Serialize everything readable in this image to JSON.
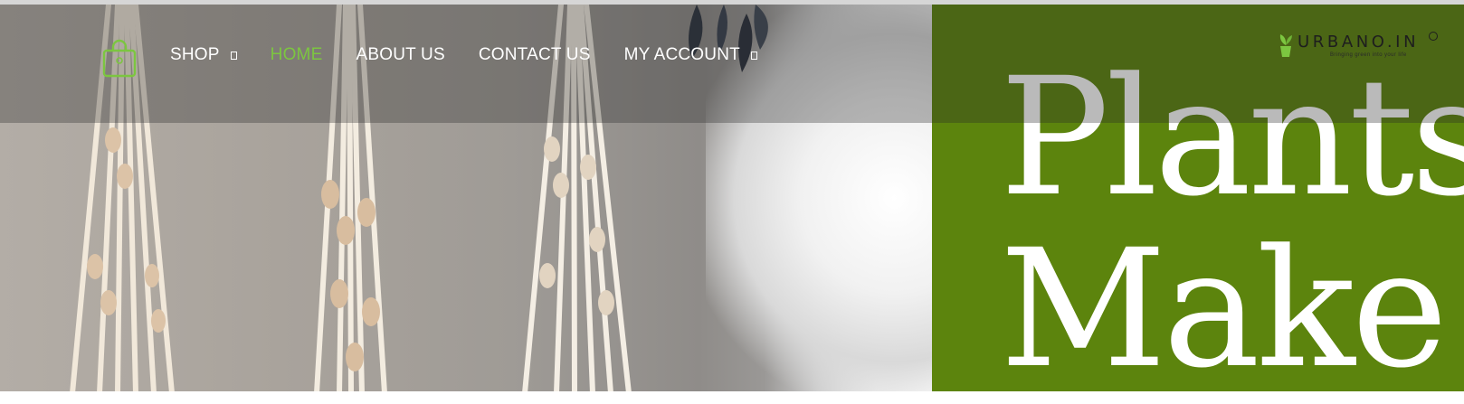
{
  "nav": {
    "items": [
      {
        "label": "SHOP",
        "has_dropdown": true,
        "active": false
      },
      {
        "label": "HOME",
        "has_dropdown": false,
        "active": true
      },
      {
        "label": "ABOUT US",
        "has_dropdown": false,
        "active": false
      },
      {
        "label": "CONTACT US",
        "has_dropdown": false,
        "active": false
      },
      {
        "label": "MY ACCOUNT",
        "has_dropdown": true,
        "active": false
      }
    ]
  },
  "header": {
    "cart_icon": "shopping-bag-icon",
    "logo": {
      "text": "URBANO.IN",
      "tagline": "Bringing green into your life"
    }
  },
  "hero": {
    "headline_line1": "Plants",
    "headline_line2": "Make",
    "image": "macrame-plant-hangers-photo"
  },
  "colors": {
    "accent_green": "#7cc640",
    "panel_green": "#5c840d",
    "nav_text": "#ffffff"
  }
}
